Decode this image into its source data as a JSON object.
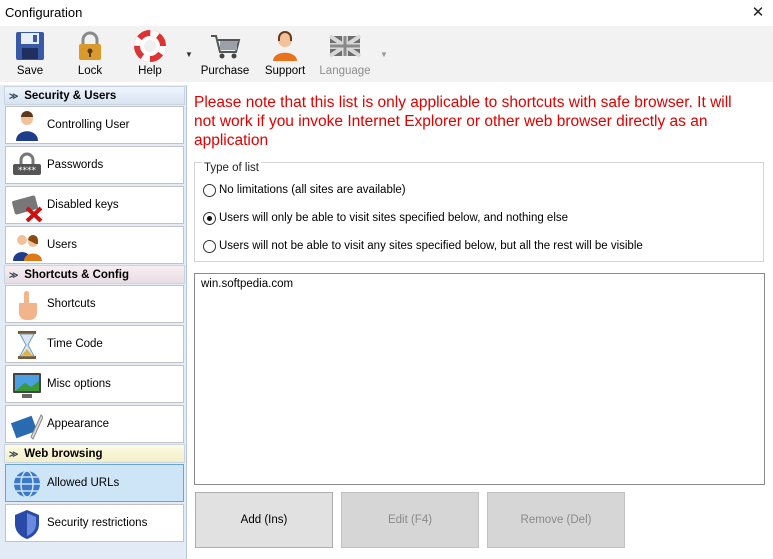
{
  "window": {
    "title": "Configuration",
    "close_glyph": "✕"
  },
  "toolbar": {
    "buttons": [
      {
        "label": "Save",
        "icon": "floppy-disk-icon"
      },
      {
        "label": "Lock",
        "icon": "padlock-icon"
      },
      {
        "label": "Help",
        "icon": "lifebuoy-icon"
      },
      {
        "label": "Purchase",
        "icon": "shopping-cart-icon"
      },
      {
        "label": "Support",
        "icon": "support-agent-icon"
      },
      {
        "label": "Language",
        "icon": "uk-flag-icon",
        "disabled": true
      }
    ],
    "dropdown_glyph": "▼"
  },
  "sidebar": {
    "groups": [
      {
        "title": "Security & Users",
        "items": [
          {
            "label": "Controlling User",
            "icon": "user-icon"
          },
          {
            "label": "Passwords",
            "icon": "password-icon"
          },
          {
            "label": "Disabled keys",
            "icon": "disabled-keyboard-icon"
          },
          {
            "label": "Users",
            "icon": "users-icon"
          }
        ]
      },
      {
        "title": "Shortcuts & Config",
        "items": [
          {
            "label": "Shortcuts",
            "icon": "hand-pointer-icon"
          },
          {
            "label": "Time Code",
            "icon": "hourglass-icon"
          },
          {
            "label": "Misc options",
            "icon": "monitor-icon"
          },
          {
            "label": "Appearance",
            "icon": "paint-pen-icon"
          }
        ]
      },
      {
        "title": "Web browsing",
        "items": [
          {
            "label": "Allowed URLs",
            "icon": "globe-icon",
            "active": true
          },
          {
            "label": "Security restrictions",
            "icon": "shield-icon"
          }
        ]
      }
    ],
    "chevron_glyph": "≫"
  },
  "main": {
    "note": "Please note that this list is only applicable to shortcuts with safe browser. It will not work if you invoke Internet Explorer or other web browser directly as an application",
    "type_of_list": {
      "legend": "Type of list",
      "options": [
        {
          "label": "No limitations (all sites are available)",
          "selected": false
        },
        {
          "label": "Users will only be able to visit sites specified below, and nothing else",
          "selected": true
        },
        {
          "label": "Users will not be able to visit any sites specified below, but all the rest will be visible",
          "selected": false
        }
      ]
    },
    "urls": [
      "win.softpedia.com"
    ],
    "buttons": [
      {
        "label": "Add (Ins)",
        "disabled": false
      },
      {
        "label": "Edit (F4)",
        "disabled": true
      },
      {
        "label": "Remove (Del)",
        "disabled": true
      }
    ]
  }
}
